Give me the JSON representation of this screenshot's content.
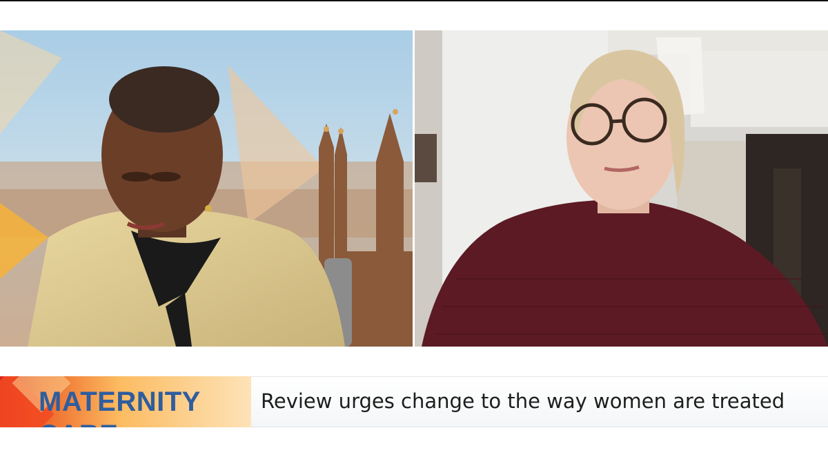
{
  "broadcast": {
    "lower_third": {
      "label": "MATERNITY CARE",
      "headline": "Review urges change to the way women are treated"
    },
    "panels": [
      {
        "role": "studio guest",
        "background": "Westminster backdrop"
      },
      {
        "role": "remote guest",
        "background": "home interior"
      }
    ]
  },
  "colors": {
    "label_text": "#2f5d9e",
    "label_gradient_start": "#d7261f",
    "label_gradient_end": "#fde3b8",
    "headline_text": "#1d1d1d"
  }
}
